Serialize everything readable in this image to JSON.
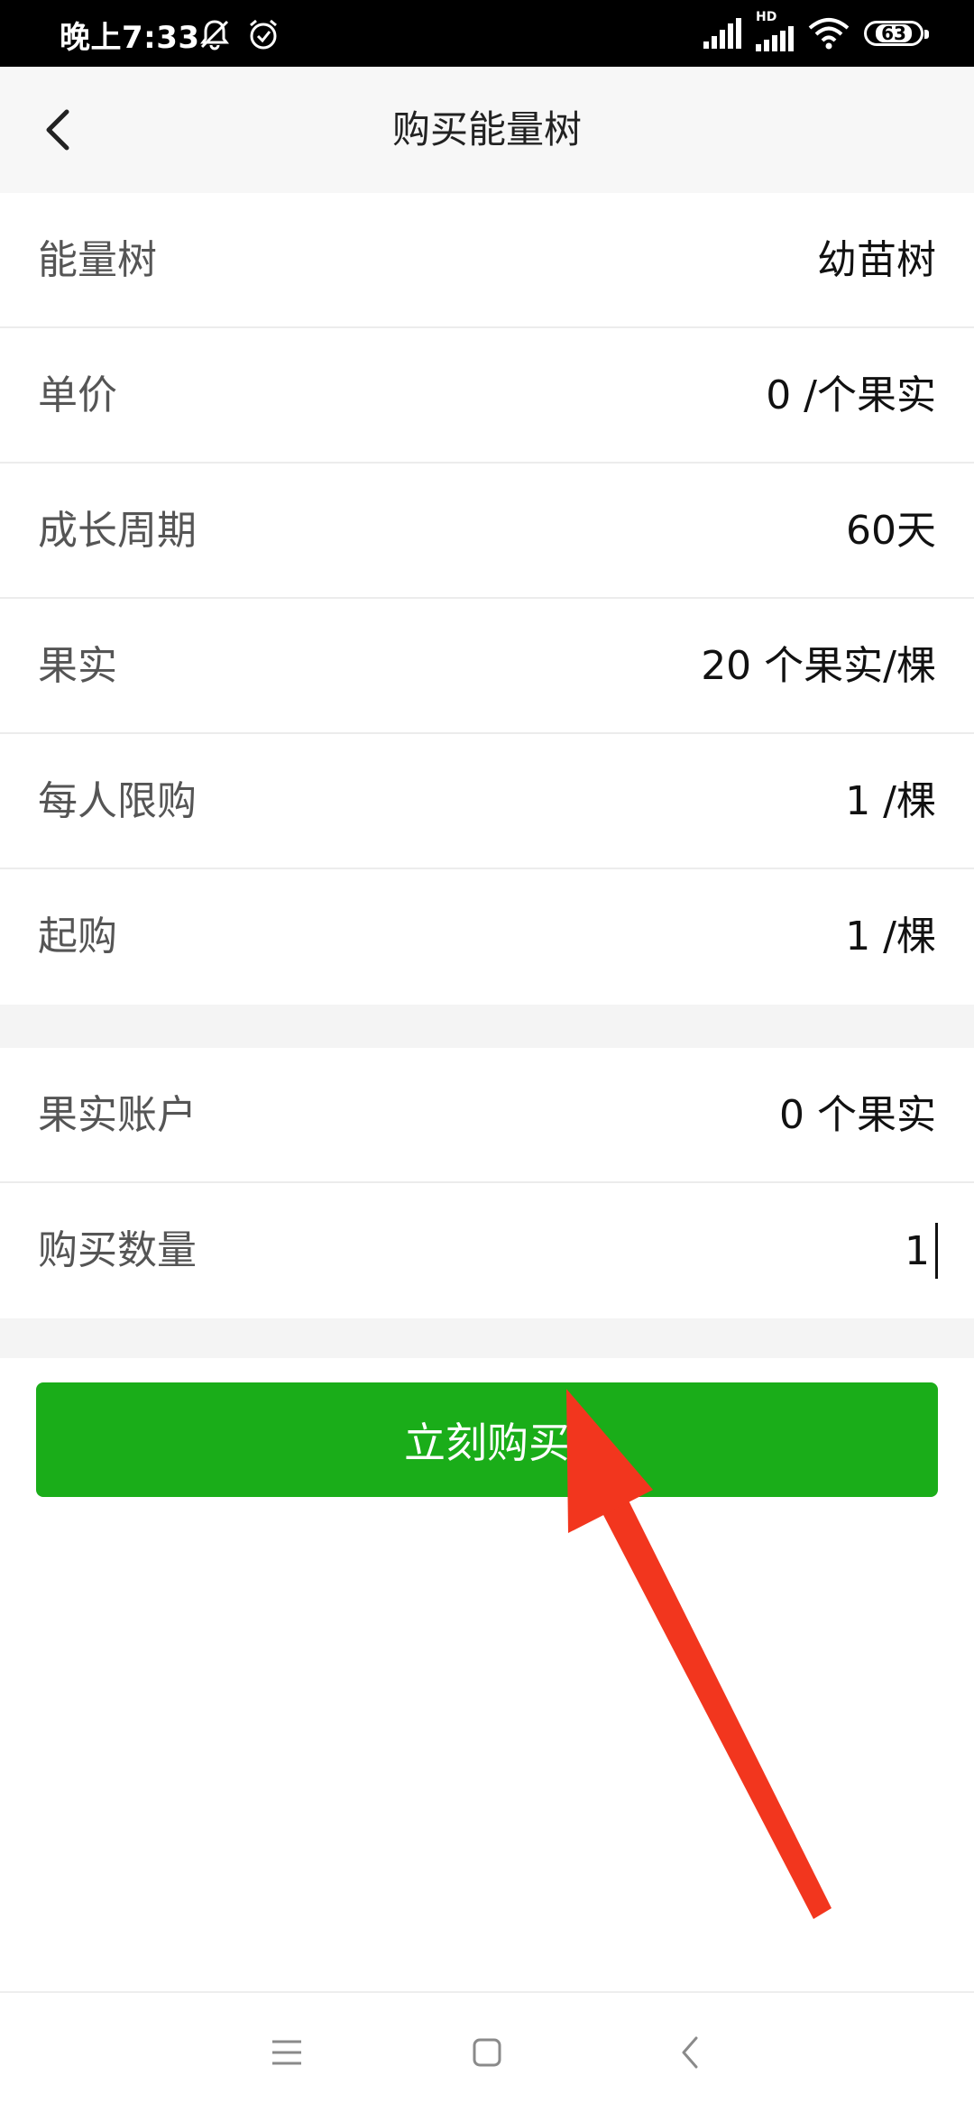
{
  "status_bar": {
    "time": "晚上7:33",
    "battery": "63",
    "network_label": "HD"
  },
  "nav": {
    "title": "购买能量树"
  },
  "info_rows": [
    {
      "label": "能量树",
      "value": "幼苗树"
    },
    {
      "label": "单价",
      "value": "0 /个果实"
    },
    {
      "label": "成长周期",
      "value": "60天"
    },
    {
      "label": "果实",
      "value": "20 个果实/棵"
    },
    {
      "label": "每人限购",
      "value": "1 /棵"
    },
    {
      "label": "起购",
      "value": "1 /棵"
    }
  ],
  "account_rows": {
    "fruit_account": {
      "label": "果实账户",
      "value": "0 个果实"
    },
    "quantity": {
      "label": "购买数量",
      "value": "1"
    }
  },
  "buy_button": {
    "label": "立刻购买"
  },
  "colors": {
    "accent_green": "#1aad19",
    "annotation_red": "#f2361e"
  },
  "icons": [
    "bell-off-icon",
    "alarm-icon",
    "signal-icon",
    "wifi-icon",
    "battery-icon",
    "back-chevron-icon",
    "menu-icon",
    "home-icon",
    "back-icon"
  ]
}
